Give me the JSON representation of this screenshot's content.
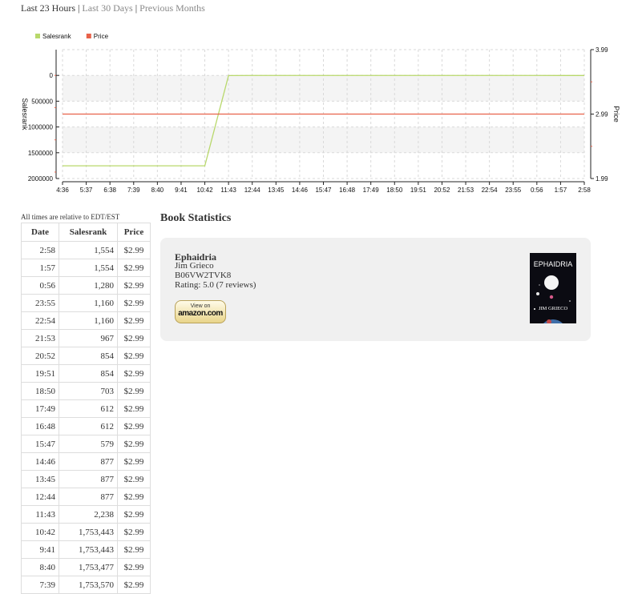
{
  "nav": {
    "current": "Last 23 Hours",
    "sep": "|",
    "link_30": "Last 30 Days",
    "link_prev": "Previous Months"
  },
  "colors": {
    "salesrank": "#b8d86b",
    "price": "#e8624a",
    "grid": "#d9d9d9",
    "band": "#f4f4f4",
    "card": "#f0f0f0"
  },
  "chart_data": {
    "type": "line",
    "legend_position": "top-left",
    "x_tick_labels": [
      "4:36",
      "5:37",
      "6:38",
      "7:39",
      "8:40",
      "9:41",
      "10:42",
      "11:43",
      "12:44",
      "13:45",
      "14:46",
      "15:47",
      "16:48",
      "17:49",
      "18:50",
      "19:51",
      "20:52",
      "21:53",
      "22:54",
      "23:55",
      "0:56",
      "1:57",
      "2:58"
    ],
    "left_axis": {
      "label": "Salesrank",
      "reversed": true,
      "ylim": [
        -500000,
        2000000
      ],
      "ticks": [
        0,
        500000,
        1000000,
        1500000,
        2000000
      ]
    },
    "right_axis": {
      "label": "Price",
      "ylim": [
        1.99,
        3.99
      ],
      "ticks": [
        1.99,
        2.99,
        3.99
      ]
    },
    "series": [
      {
        "name": "Salesrank",
        "axis": "left",
        "color": "#b8d86b",
        "values": [
          1753570,
          1753570,
          1753570,
          1753570,
          1753477,
          1753443,
          1753443,
          2238,
          877,
          877,
          877,
          579,
          612,
          612,
          703,
          854,
          854,
          967,
          1160,
          1160,
          1280,
          1554,
          1554
        ]
      },
      {
        "name": "Price",
        "axis": "right",
        "color": "#e8624a",
        "values": [
          2.99,
          2.99,
          2.99,
          2.99,
          2.99,
          2.99,
          2.99,
          2.99,
          2.99,
          2.99,
          2.99,
          2.99,
          2.99,
          2.99,
          2.99,
          2.99,
          2.99,
          2.99,
          2.99,
          2.99,
          2.99,
          2.99,
          2.99
        ]
      }
    ],
    "grid": true
  },
  "table": {
    "note": "All times are relative to EDT/EST",
    "headers": [
      "Date",
      "Salesrank",
      "Price"
    ],
    "rows": [
      [
        "2:58",
        "1,554",
        "$2.99"
      ],
      [
        "1:57",
        "1,554",
        "$2.99"
      ],
      [
        "0:56",
        "1,280",
        "$2.99"
      ],
      [
        "23:55",
        "1,160",
        "$2.99"
      ],
      [
        "22:54",
        "1,160",
        "$2.99"
      ],
      [
        "21:53",
        "967",
        "$2.99"
      ],
      [
        "20:52",
        "854",
        "$2.99"
      ],
      [
        "19:51",
        "854",
        "$2.99"
      ],
      [
        "18:50",
        "703",
        "$2.99"
      ],
      [
        "17:49",
        "612",
        "$2.99"
      ],
      [
        "16:48",
        "612",
        "$2.99"
      ],
      [
        "15:47",
        "579",
        "$2.99"
      ],
      [
        "14:46",
        "877",
        "$2.99"
      ],
      [
        "13:45",
        "877",
        "$2.99"
      ],
      [
        "12:44",
        "877",
        "$2.99"
      ],
      [
        "11:43",
        "2,238",
        "$2.99"
      ],
      [
        "10:42",
        "1,753,443",
        "$2.99"
      ],
      [
        "9:41",
        "1,753,443",
        "$2.99"
      ],
      [
        "8:40",
        "1,753,477",
        "$2.99"
      ],
      [
        "7:39",
        "1,753,570",
        "$2.99"
      ]
    ]
  },
  "book": {
    "section_title": "Book Statistics",
    "title": "Ephaidria",
    "author": "Jim Grieco",
    "asin": "B06VW2TVK8",
    "rating": "Rating: 5.0  (7 reviews)",
    "button_top": "View on",
    "button_brand": "amazon.com",
    "cover_title": "EPHAIDRIA",
    "cover_author": "JIM GRIECO"
  }
}
